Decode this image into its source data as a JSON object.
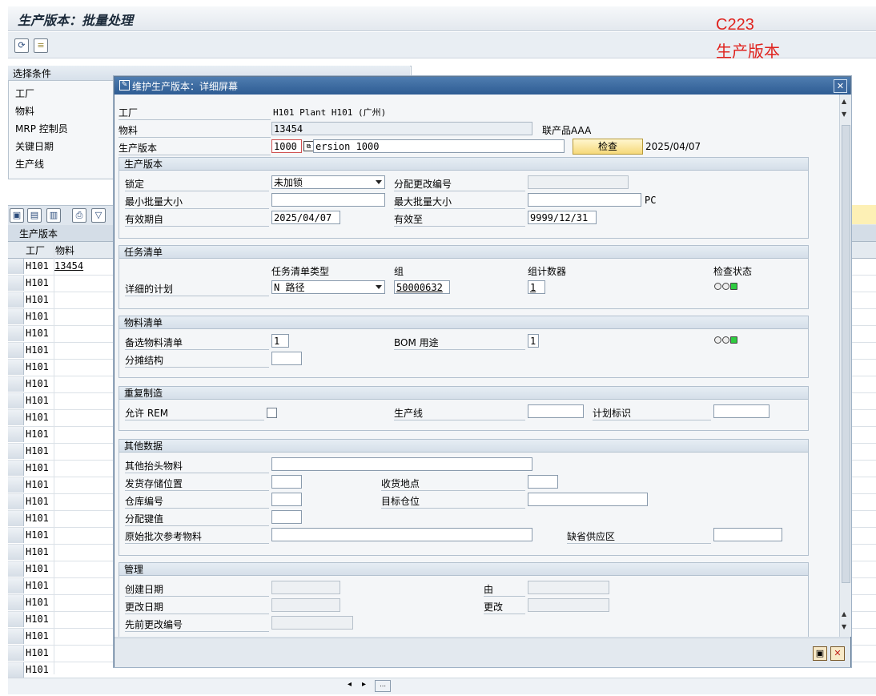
{
  "background": {
    "title": "生产版本：批量处理",
    "annotation_code": "C223",
    "annotation_name": "生产版本",
    "selection": {
      "title": "选择条件",
      "fields": [
        "工厂",
        "物料",
        "MRP 控制员",
        "关键日期",
        "生产线"
      ]
    },
    "grid": {
      "section_title": "生产版本",
      "col_plant": "工厂",
      "col_material": "物料",
      "rows": [
        {
          "plant": "H101",
          "material": "13454"
        },
        {
          "plant": "H101",
          "material": ""
        },
        {
          "plant": "H101",
          "material": ""
        },
        {
          "plant": "H101",
          "material": ""
        },
        {
          "plant": "H101",
          "material": ""
        },
        {
          "plant": "H101",
          "material": ""
        },
        {
          "plant": "H101",
          "material": ""
        },
        {
          "plant": "H101",
          "material": ""
        },
        {
          "plant": "H101",
          "material": ""
        },
        {
          "plant": "H101",
          "material": ""
        },
        {
          "plant": "H101",
          "material": ""
        },
        {
          "plant": "H101",
          "material": ""
        },
        {
          "plant": "H101",
          "material": ""
        },
        {
          "plant": "H101",
          "material": ""
        },
        {
          "plant": "H101",
          "material": ""
        },
        {
          "plant": "H101",
          "material": ""
        },
        {
          "plant": "H101",
          "material": ""
        },
        {
          "plant": "H101",
          "material": ""
        },
        {
          "plant": "H101",
          "material": ""
        },
        {
          "plant": "H101",
          "material": ""
        },
        {
          "plant": "H101",
          "material": ""
        },
        {
          "plant": "H101",
          "material": ""
        },
        {
          "plant": "H101",
          "material": ""
        },
        {
          "plant": "H101",
          "material": ""
        },
        {
          "plant": "H101",
          "material": ""
        }
      ]
    }
  },
  "dialog": {
    "title": "维护生产版本：详细屏幕",
    "header": {
      "plant_label": "工厂",
      "plant_value": "H101  Plant H101 (广州)",
      "material_label": "物料",
      "material_value": "13454",
      "material_desc": "联产品AAA",
      "version_label": "生产版本",
      "version_value": "1000",
      "version_text": "ersion 1000",
      "check_button": "检查",
      "check_date": "2025/04/07"
    },
    "prod_version": {
      "title": "生产版本",
      "lock_label": "锁定",
      "lock_value": "未加锁",
      "change_no_label": "分配更改编号",
      "min_lot_label": "最小批量大小",
      "max_lot_label": "最大批量大小",
      "unit": "PC",
      "valid_from_label": "有效期自",
      "valid_from": "2025/04/07",
      "valid_to_label": "有效至",
      "valid_to": "9999/12/31"
    },
    "task_list": {
      "title": "任务清单",
      "col_type": "任务清单类型",
      "col_group": "组",
      "col_counter": "组计数器",
      "col_status": "检查状态",
      "row_label": "详细的计划",
      "type_value": "N 路径",
      "group_value": "50000632",
      "counter_value": "1"
    },
    "bom": {
      "title": "物料清单",
      "alt_label": "备选物料清单",
      "alt_value": "1",
      "usage_label": "BOM 用途",
      "usage_value": "1",
      "apportion_label": "分摊结构"
    },
    "rem": {
      "title": "重复制造",
      "allow_label": "允许 REM",
      "line_label": "生产线",
      "plan_id_label": "计划标识"
    },
    "other": {
      "title": "其他数据",
      "other_header_material": "其他抬头物料",
      "issue_sloc": "发货存储位置",
      "receiving_sloc": "收货地点",
      "warehouse_no": "仓库编号",
      "dest_bin": "目标仓位",
      "distribution_key": "分配键值",
      "orig_batch_ref": "原始批次参考物料",
      "default_supply_area": "缺省供应区"
    },
    "admin": {
      "title": "管理",
      "created_on": "创建日期",
      "created_by": "由",
      "changed_on": "更改日期",
      "changed_by": "更改",
      "prev_change_no": "先前更改编号"
    }
  },
  "colors": {
    "dialog_title_bg": "#2e5c93",
    "annotation": "#e0231e",
    "check_button": "#f6d97a",
    "status_green": "#2ecc40"
  }
}
